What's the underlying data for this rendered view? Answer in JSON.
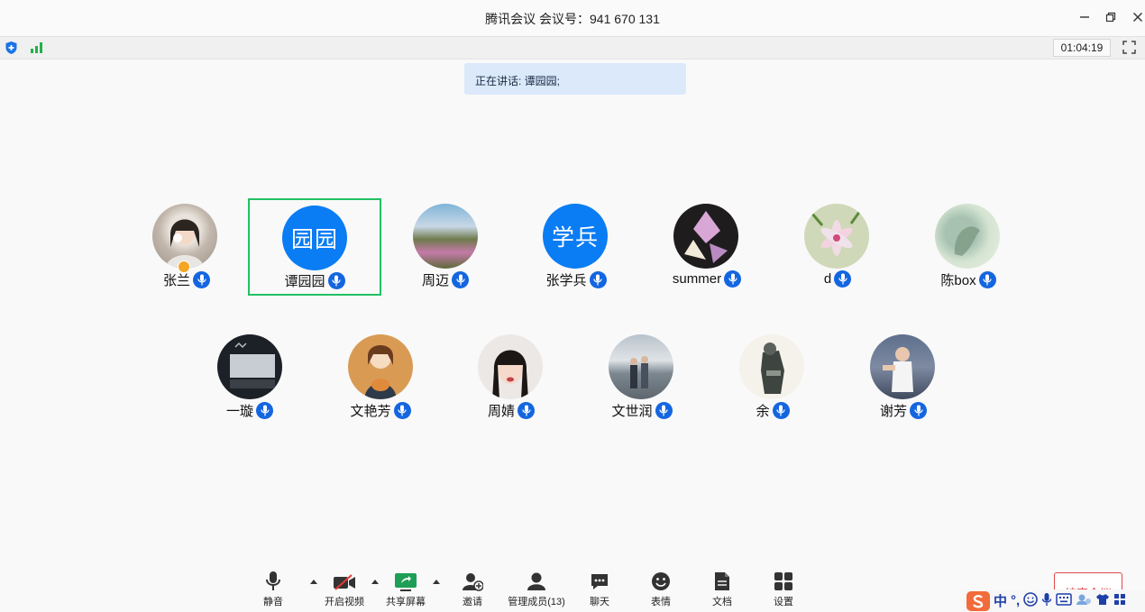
{
  "window": {
    "title": "腾讯会议 会议号：941 670 131",
    "timer": "01:04:19"
  },
  "speaking_banner": "正在讲话: 谭园园;",
  "participants": [
    {
      "name": "张兰",
      "initials": ""
    },
    {
      "name": "谭园园",
      "initials": "园园"
    },
    {
      "name": "周迈",
      "initials": ""
    },
    {
      "name": "张学兵",
      "initials": "学兵"
    },
    {
      "name": "summer",
      "initials": ""
    },
    {
      "name": "d",
      "initials": ""
    },
    {
      "name": "陈box",
      "initials": ""
    },
    {
      "name": "一璇",
      "initials": ""
    },
    {
      "name": "文艳芳",
      "initials": ""
    },
    {
      "name": "周婧",
      "initials": ""
    },
    {
      "name": "文世润",
      "initials": ""
    },
    {
      "name": "余",
      "initials": ""
    },
    {
      "name": "谢芳",
      "initials": ""
    }
  ],
  "toolbar": {
    "mute": "静音",
    "video": "开启视频",
    "share": "共享屏幕",
    "invite": "邀请",
    "members": "管理成员(13)",
    "chat": "聊天",
    "emoji": "表情",
    "docs": "文档",
    "settings": "设置"
  },
  "end_meeting": "结束会议",
  "ime": {
    "mode": "中",
    "punct": "°,"
  },
  "colors": {
    "accent_blue": "#0a7cf4",
    "active_green": "#22c063",
    "end_red": "#e04848",
    "banner_bg": "#dbe9fb"
  }
}
